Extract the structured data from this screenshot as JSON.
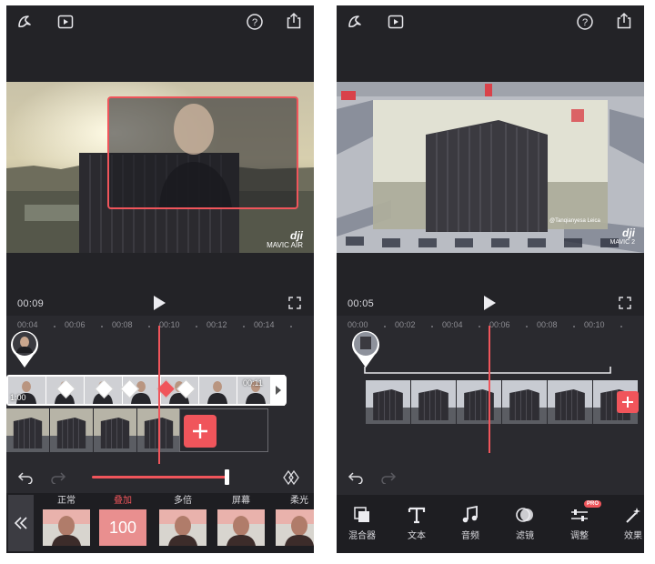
{
  "left": {
    "timecode": "00:09",
    "ruler": [
      "00:04",
      "00:06",
      "00:08",
      "00:10",
      "00:12",
      "00:14"
    ],
    "watermark": {
      "brand": "dji",
      "model": "MAVIC AIR"
    },
    "clip_duration": "00:11",
    "clip_start": "1:00",
    "opacity_value": "100",
    "modes": [
      {
        "label": "正常"
      },
      {
        "label": "叠加",
        "active": true
      },
      {
        "label": "多倍"
      },
      {
        "label": "屏幕"
      },
      {
        "label": "柔光"
      }
    ],
    "colors": {
      "accent": "#f0555b",
      "bg": "#232327"
    },
    "icons": {
      "back": "double-chevron-left",
      "undo": "undo-arrow",
      "redo": "redo-arrow",
      "keyframe": "diamond-keyframe"
    }
  },
  "right": {
    "timecode": "00:05",
    "ruler": [
      "00:00",
      "00:02",
      "00:04",
      "00:06",
      "00:08",
      "00:10"
    ],
    "watermark_credit": "@Tanqianyesa Leica",
    "watermark": {
      "brand": "dji",
      "model": "MAVIC 2"
    },
    "tools": [
      {
        "label": "混合器",
        "icon": "blend-icon"
      },
      {
        "label": "文本",
        "icon": "text-icon"
      },
      {
        "label": "音频",
        "icon": "music-icon"
      },
      {
        "label": "滤镜",
        "icon": "filter-icon"
      },
      {
        "label": "调整",
        "icon": "adjust-icon",
        "badge": "PRO"
      },
      {
        "label": "效果",
        "icon": "effects-icon"
      }
    ]
  }
}
